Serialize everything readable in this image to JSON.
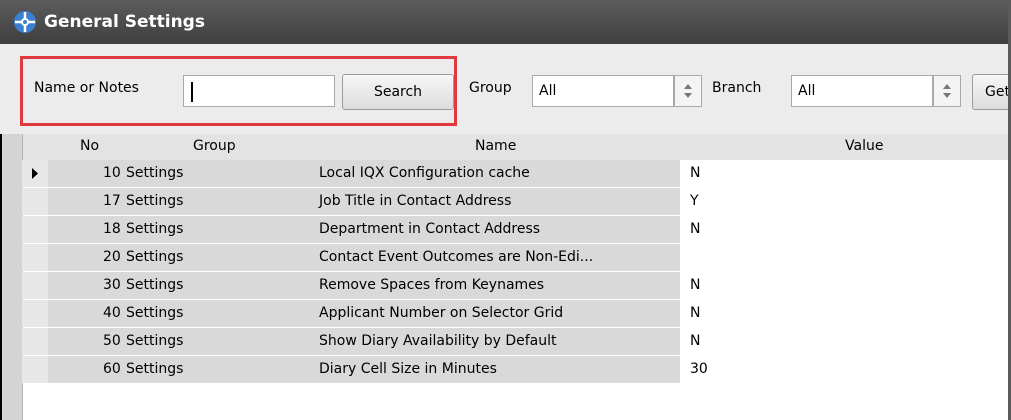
{
  "window": {
    "title": "General Settings",
    "icon": "settings-gear-icon"
  },
  "toolbar": {
    "search_label": "Name or Notes",
    "search_value": "",
    "search_button": "Search",
    "group_label": "Group",
    "group_value": "All",
    "branch_label": "Branch",
    "branch_value": "All",
    "get_button": "Get"
  },
  "grid": {
    "columns": [
      "No",
      "Group",
      "Name",
      "Value"
    ],
    "rows": [
      {
        "no": "10",
        "group": "Settings",
        "name": "Local IQX Configuration cache",
        "value": "N"
      },
      {
        "no": "17",
        "group": "Settings",
        "name": "Job Title in Contact Address",
        "value": "Y"
      },
      {
        "no": "18",
        "group": "Settings",
        "name": "Department in Contact Address",
        "value": "N"
      },
      {
        "no": "20",
        "group": "Settings",
        "name": "Contact Event Outcomes are Non-Edi...",
        "value": ""
      },
      {
        "no": "30",
        "group": "Settings",
        "name": "Remove Spaces from Keynames",
        "value": "N"
      },
      {
        "no": "40",
        "group": "Settings",
        "name": "Applicant Number on Selector Grid",
        "value": "N"
      },
      {
        "no": "50",
        "group": "Settings",
        "name": "Show Diary Availability by Default",
        "value": "N"
      },
      {
        "no": "60",
        "group": "Settings",
        "name": "Diary Cell Size in Minutes",
        "value": "30"
      }
    ]
  }
}
